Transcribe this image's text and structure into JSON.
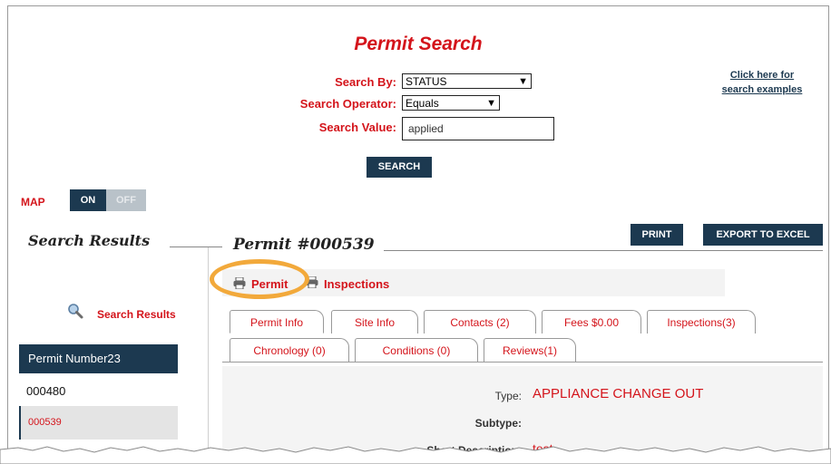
{
  "header": {
    "title": "Permit Search",
    "search_by_label": "Search By:",
    "search_by_value": "STATUS",
    "search_operator_label": "Search Operator:",
    "search_operator_value": "Equals",
    "search_value_label": "Search Value:",
    "search_value": "applied",
    "search_button": "SEARCH",
    "examples_link_line1": "Click here for",
    "examples_link_line2": "search examples"
  },
  "map": {
    "label": "MAP",
    "on": "ON",
    "off": "OFF"
  },
  "sidebar": {
    "heading": "Search Results",
    "search_results_link": "Search Results",
    "table_header": "Permit Number23",
    "rows": [
      "000480",
      "000539"
    ]
  },
  "detail": {
    "heading": "Permit #000539",
    "print_button": "PRINT",
    "export_button": "EXPORT TO EXCEL",
    "print_links": [
      "Permit",
      "Inspections"
    ],
    "tabs_row1": [
      "Permit Info",
      "Site Info",
      "Contacts (2)",
      "Fees $0.00",
      "Inspections(3)"
    ],
    "tabs_row2": [
      "Chronology (0)",
      "Conditions (0)",
      "Reviews(1)"
    ],
    "fields": {
      "type_label": "Type:",
      "type_value": "APPLIANCE CHANGE OUT",
      "subtype_label": "Subtype:",
      "subtype_value": "",
      "short_desc_label": "Short Description:",
      "short_desc_value": "test"
    }
  },
  "colors": {
    "accent_red": "#d4141b",
    "navy": "#1c3950",
    "highlight_ring": "#f2a93b"
  }
}
